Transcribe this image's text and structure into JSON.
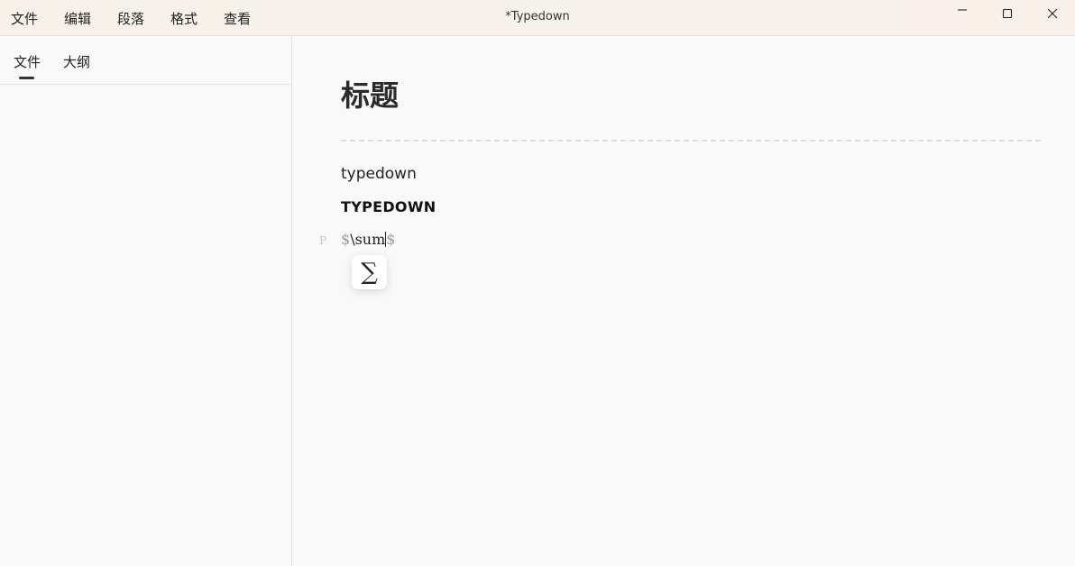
{
  "menu": {
    "items": [
      "文件",
      "编辑",
      "段落",
      "格式",
      "查看"
    ]
  },
  "window": {
    "title": "*Typedown"
  },
  "sidebar": {
    "tabs": [
      "文件",
      "大纲"
    ],
    "active_tab": 0
  },
  "document": {
    "heading": "标题",
    "paragraph_1": "typedown",
    "paragraph_2": "TYPEDOWN",
    "paragraph_marker": "P",
    "math": {
      "open": "$",
      "source": "\\sum",
      "close": "$",
      "preview": "∑"
    }
  }
}
